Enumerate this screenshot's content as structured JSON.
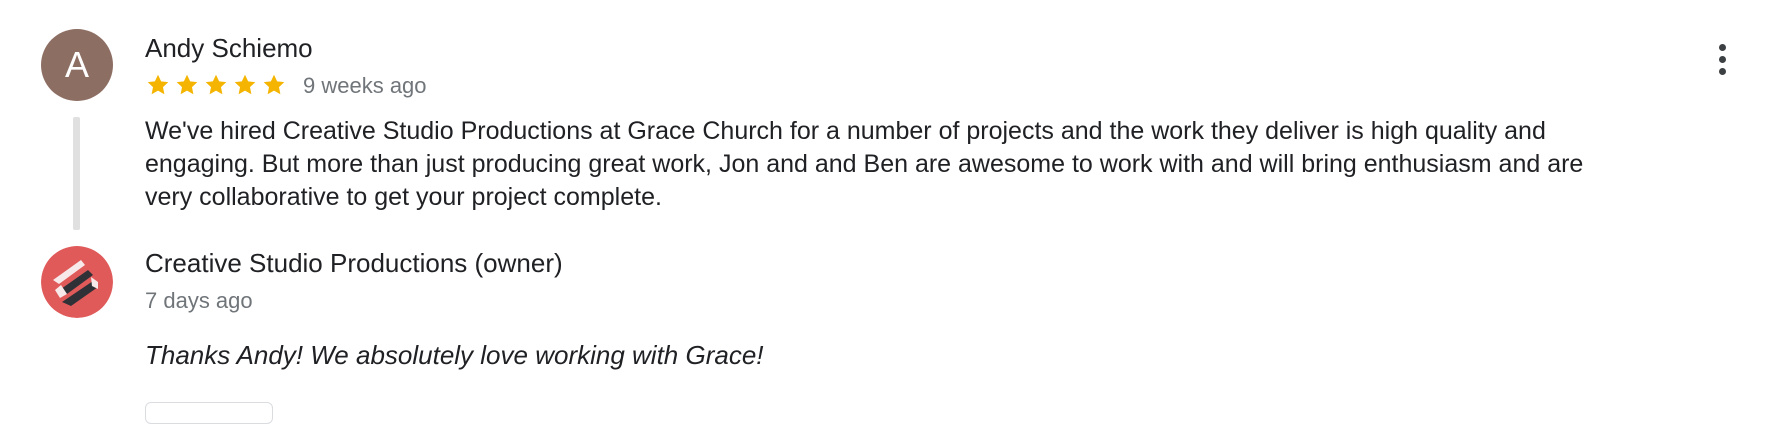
{
  "review": {
    "author_initial": "A",
    "author_name": "Andy Schiemo",
    "rating": 5,
    "rating_max": 5,
    "date": "9 weeks ago",
    "text": "We've hired Creative Studio Productions at Grace Church for a number of projects and the work they deliver is high quality and engaging. But more than just producing great work, Jon and and Ben are awesome to work with and will bring enthusiasm and are very collaborative to get your project complete.",
    "avatar_color": "#8d6e63",
    "star_color": "#f4b400"
  },
  "owner_response": {
    "name": "Creative Studio Productions (owner)",
    "date": "7 days ago",
    "text": "Thanks Andy! We absolutely love working with Grace!",
    "avatar_color": "#e05a5a"
  },
  "icons": {
    "more": "more-vert-icon",
    "star": "star-icon",
    "owner_logo": "creative-studio-logo"
  }
}
